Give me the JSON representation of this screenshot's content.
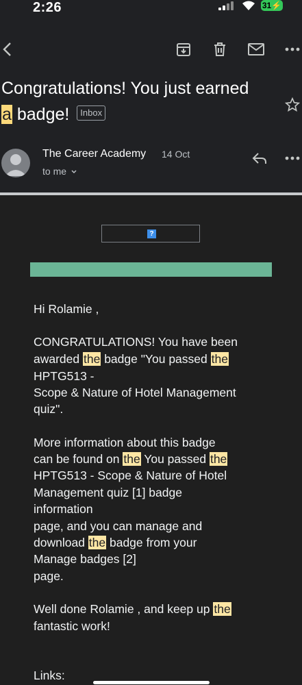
{
  "status_bar": {
    "time": "2:26",
    "battery": "31⚡"
  },
  "toolbar": {
    "icons": [
      "back-arrow-icon",
      "archive-icon",
      "delete-icon",
      "mark-unread-icon",
      "more-icon"
    ]
  },
  "email": {
    "subject_part1": "Congratulations! You just earned",
    "subject_hl": "a",
    "subject_part2": " badge!",
    "label": "Inbox",
    "sender": "The Career Academy",
    "date": "14 Oct",
    "recipient": "to me",
    "body": {
      "greeting": "Hi Rolamie ,",
      "p1_l1": "CONGRATULATIONS! You have been",
      "p1_l2_a": "awarded ",
      "p1_l2_b": " badge \"You passed ",
      "p1_l3": "HPTG513 -",
      "p1_l4": "Scope & Nature of Hotel Management",
      "p1_l5": "quiz\".",
      "p2_l1": "More information about this badge",
      "p2_l2_a": "can be found on ",
      "p2_l2_b": " You passed ",
      "p2_l3": "HPTG513 - Scope & Nature of Hotel",
      "p2_l4": "Management quiz [1] badge",
      "p2_l5": "information",
      "p2_l6": "page, and you can manage and",
      "p2_l7_a": "download ",
      "p2_l7_b": " badge from your",
      "p2_l8": "Manage badges [2]",
      "p2_l9": "page.",
      "p3_l1": "Well done Rolamie , and keep up ",
      "p3_l2": "fantastic work!",
      "links_label": "Links:",
      "highlight_word": "the"
    }
  },
  "colors": {
    "background": "#202124",
    "highlight": "#fcd97b",
    "banner": "#6bb596",
    "battery": "#34c759"
  }
}
